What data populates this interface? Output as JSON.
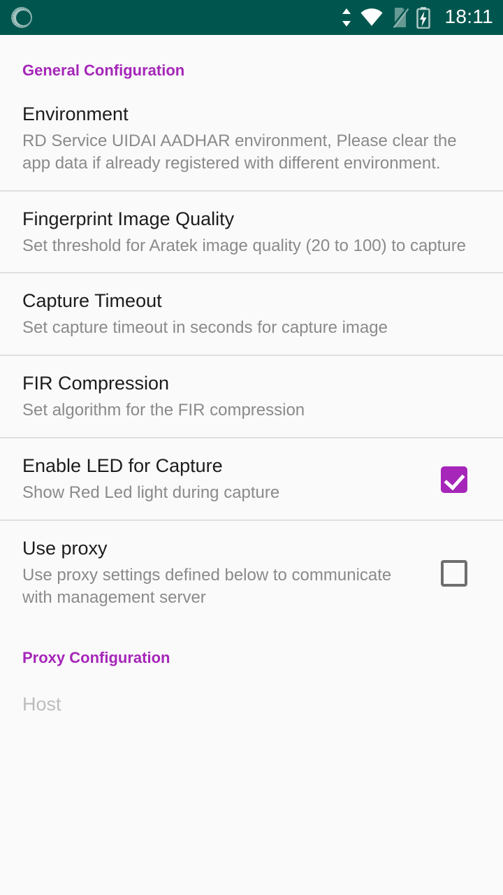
{
  "status_bar": {
    "notification_icon": "sync-circle-icon",
    "icons": [
      "data-transfer-icon",
      "wifi-icon",
      "sim-off-icon",
      "battery-charging-icon"
    ],
    "time": "18:11",
    "background_color": "#00564e",
    "foreground_color": "#ffffff"
  },
  "theme": {
    "accent_color": "#a526b8",
    "background_color": "#fafafa",
    "title_color": "#1c1c1c",
    "summary_color": "#8a8a8a",
    "divider_color": "#e0e0e0",
    "disabled_color": "#bdbdbd"
  },
  "categories": [
    {
      "id": "general",
      "header": "General Configuration",
      "items": [
        {
          "title": "Environment",
          "summary": "RD Service UIDAI AADHAR environment, Please clear the app data if already registered with different environment.",
          "widget": "none"
        },
        {
          "title": "Fingerprint Image Quality",
          "summary": "Set threshold for Aratek image quality (20 to 100) to capture",
          "widget": "none"
        },
        {
          "title": "Capture Timeout",
          "summary": "Set capture timeout in seconds for capture image",
          "widget": "none"
        },
        {
          "title": "FIR Compression",
          "summary": "Set algorithm for the FIR compression",
          "widget": "none"
        },
        {
          "title": "Enable LED for Capture",
          "summary": "Show Red Led light during capture",
          "widget": "checkbox",
          "checked": true
        },
        {
          "title": "Use proxy",
          "summary": "Use proxy settings defined below to communicate with management server",
          "widget": "checkbox",
          "checked": false
        }
      ]
    },
    {
      "id": "proxy",
      "header": "Proxy Configuration",
      "items": [
        {
          "title": "Host",
          "summary": "",
          "widget": "none",
          "disabled": true
        }
      ]
    }
  ]
}
